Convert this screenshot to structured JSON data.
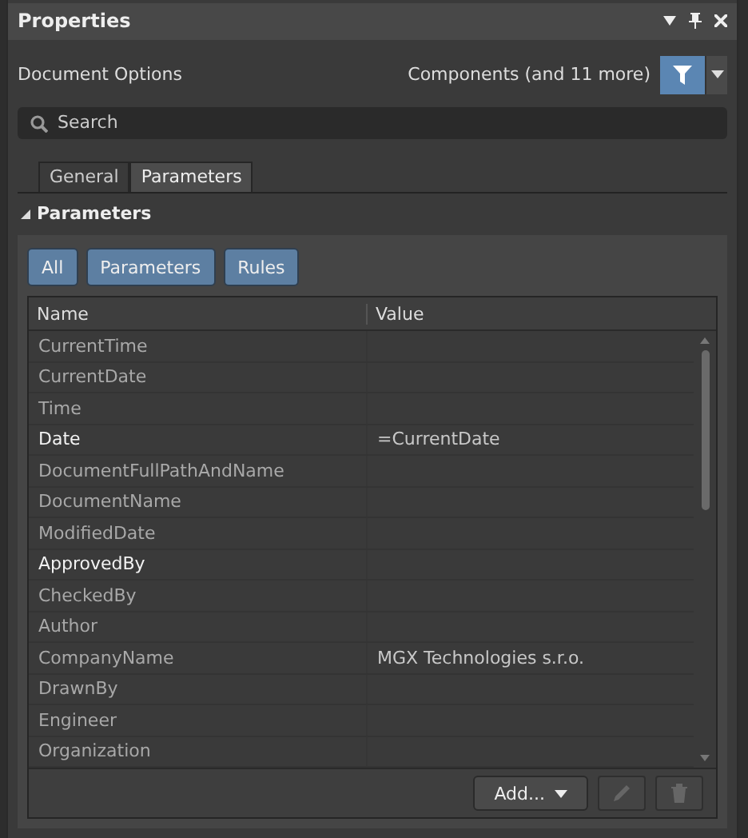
{
  "panel": {
    "title": "Properties"
  },
  "header": {
    "label": "Document Options",
    "filter_text": "Components (and 11 more)"
  },
  "search": {
    "placeholder": "Search"
  },
  "tabs": [
    {
      "label": "General",
      "selected": false
    },
    {
      "label": "Parameters",
      "selected": true
    }
  ],
  "section": {
    "title": "Parameters",
    "expanded": true
  },
  "filters": [
    {
      "label": "All",
      "selected": true
    },
    {
      "label": "Parameters",
      "selected": true
    },
    {
      "label": "Rules",
      "selected": true
    }
  ],
  "table": {
    "columns": [
      "Name",
      "Value"
    ],
    "rows": [
      {
        "name": "CurrentTime",
        "value": "",
        "emphasized": false
      },
      {
        "name": "CurrentDate",
        "value": "",
        "emphasized": false
      },
      {
        "name": "Time",
        "value": "",
        "emphasized": false
      },
      {
        "name": "Date",
        "value": "=CurrentDate",
        "emphasized": true
      },
      {
        "name": "DocumentFullPathAndName",
        "value": "",
        "emphasized": false
      },
      {
        "name": "DocumentName",
        "value": "",
        "emphasized": false
      },
      {
        "name": "ModifiedDate",
        "value": "",
        "emphasized": false
      },
      {
        "name": "ApprovedBy",
        "value": "",
        "emphasized": true
      },
      {
        "name": "CheckedBy",
        "value": "",
        "emphasized": false
      },
      {
        "name": "Author",
        "value": "",
        "emphasized": false
      },
      {
        "name": "CompanyName",
        "value": "MGX Technologies s.r.o.",
        "emphasized": false
      },
      {
        "name": "DrawnBy",
        "value": "",
        "emphasized": false
      },
      {
        "name": "Engineer",
        "value": "",
        "emphasized": false
      },
      {
        "name": "Organization",
        "value": "",
        "emphasized": false
      }
    ]
  },
  "footer": {
    "add_label": "Add..."
  }
}
